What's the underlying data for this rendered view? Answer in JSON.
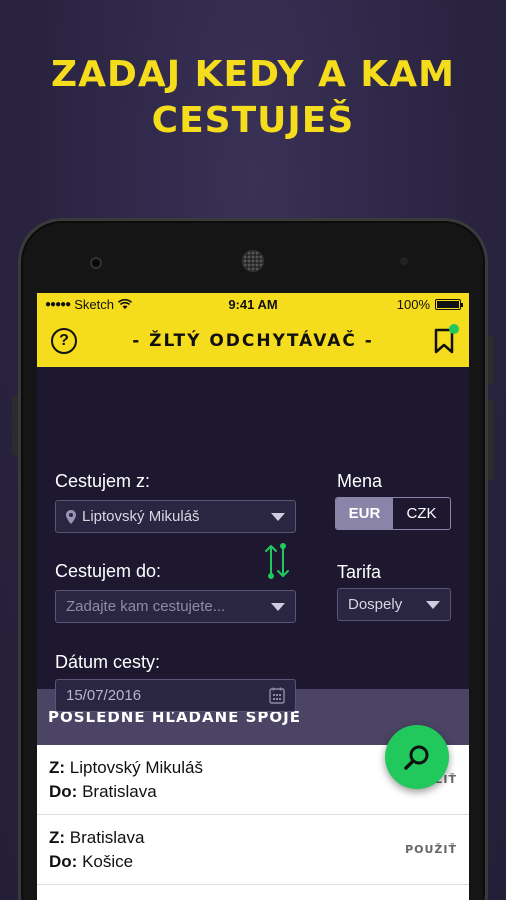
{
  "headline": {
    "line1": "ZADAJ KEDY A KAM",
    "line2": "CESTUJEŠ"
  },
  "status_bar": {
    "carrier": "Sketch",
    "time": "9:41 AM",
    "battery": "100%"
  },
  "app_bar": {
    "help": "?",
    "title": "- ŽLTÝ ODCHYTÁVAČ -"
  },
  "form": {
    "from_label": "Cestujem z:",
    "from_value": "Liptovský Mikuláš",
    "to_label": "Cestujem do:",
    "to_placeholder": "Zadajte  kam cestujete...",
    "date_label": "Dátum cesty:",
    "date_value": "15/07/2016",
    "currency_label": "Mena",
    "currency_options": [
      "EUR",
      "CZK"
    ],
    "tariff_label": "Tarifa",
    "tariff_value": "Dospely"
  },
  "recent": {
    "title": "POSLEDNÉ HĽADANÉ SPOJE",
    "from_prefix": "Z:",
    "to_prefix": "Do:",
    "use_label": "POUŽIŤ",
    "items": [
      {
        "from": "Liptovský Mikuláš",
        "to": "Bratislava"
      },
      {
        "from": "Bratislava",
        "to": "Košice"
      }
    ]
  },
  "colors": {
    "accent": "#f5dc1c",
    "fab": "#21c95d",
    "background": "#1d1830"
  }
}
